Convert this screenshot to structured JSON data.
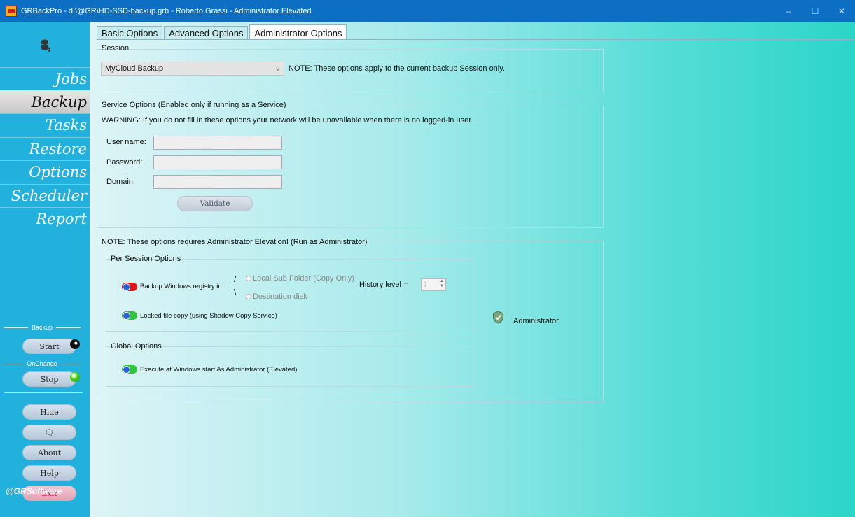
{
  "window": {
    "title": "GRBackPro - d:\\@GR\\HD-SSD-backup.grb - Roberto Grassi - Administrator Elevated",
    "minimize_glyph": "–",
    "maximize_glyph": "☐",
    "close_glyph": "✕"
  },
  "sidebar": {
    "nav": [
      "Jobs",
      "Backup",
      "Tasks",
      "Restore",
      "Options",
      "Scheduler",
      "Report"
    ],
    "active_nav": "Backup",
    "backup_label": "Backup",
    "start_label": "Start",
    "onchange_label": "OnChange",
    "stop_label": "Stop",
    "hide_label": "Hide",
    "chat_glyph": "🗨",
    "about_label": "About",
    "help_label": "Help",
    "exit_label": "Exit",
    "brand": "@GRSoftware"
  },
  "tabs": [
    "Basic Options",
    "Advanced Options",
    "Administrator Options"
  ],
  "active_tab": "Administrator Options",
  "session": {
    "group_label": "Session",
    "selected": "MyCloud Backup",
    "note": "NOTE: These options apply to the current backup Session only."
  },
  "service": {
    "group_label": "Service Options (Enabled only if running as a Service)",
    "warning": "WARNING: If you do not fill in these options your network will be unavailable when there is no logged-in user.",
    "user_label": "User name:",
    "password_label": "Password:",
    "domain_label": "Domain:",
    "user_value": "",
    "password_value": "",
    "domain_value": "",
    "validate_label": "Validate"
  },
  "admin": {
    "note": "NOTE: These options requires Administrator Elevation! (Run as Administrator)",
    "per_session_label": "Per Session Options",
    "registry_label": "Backup Windows registry in::",
    "local_sub_folder": "Local Sub Folder (Copy Only)",
    "destination_disk": "Destination disk",
    "history_label": "History level =",
    "history_value": "7",
    "locked_copy_label": "Locked file copy (using Shadow Copy Service)",
    "global_label": "Global Options",
    "execute_label": "Execute at Windows start As Administrator (Elevated)",
    "administrator_label": "Administrator"
  },
  "colors": {
    "titlebar": "#0c6fc4",
    "sidebar": "#22b1dc",
    "toggle_red": "#e0161c",
    "toggle_green": "#2ec43b"
  }
}
